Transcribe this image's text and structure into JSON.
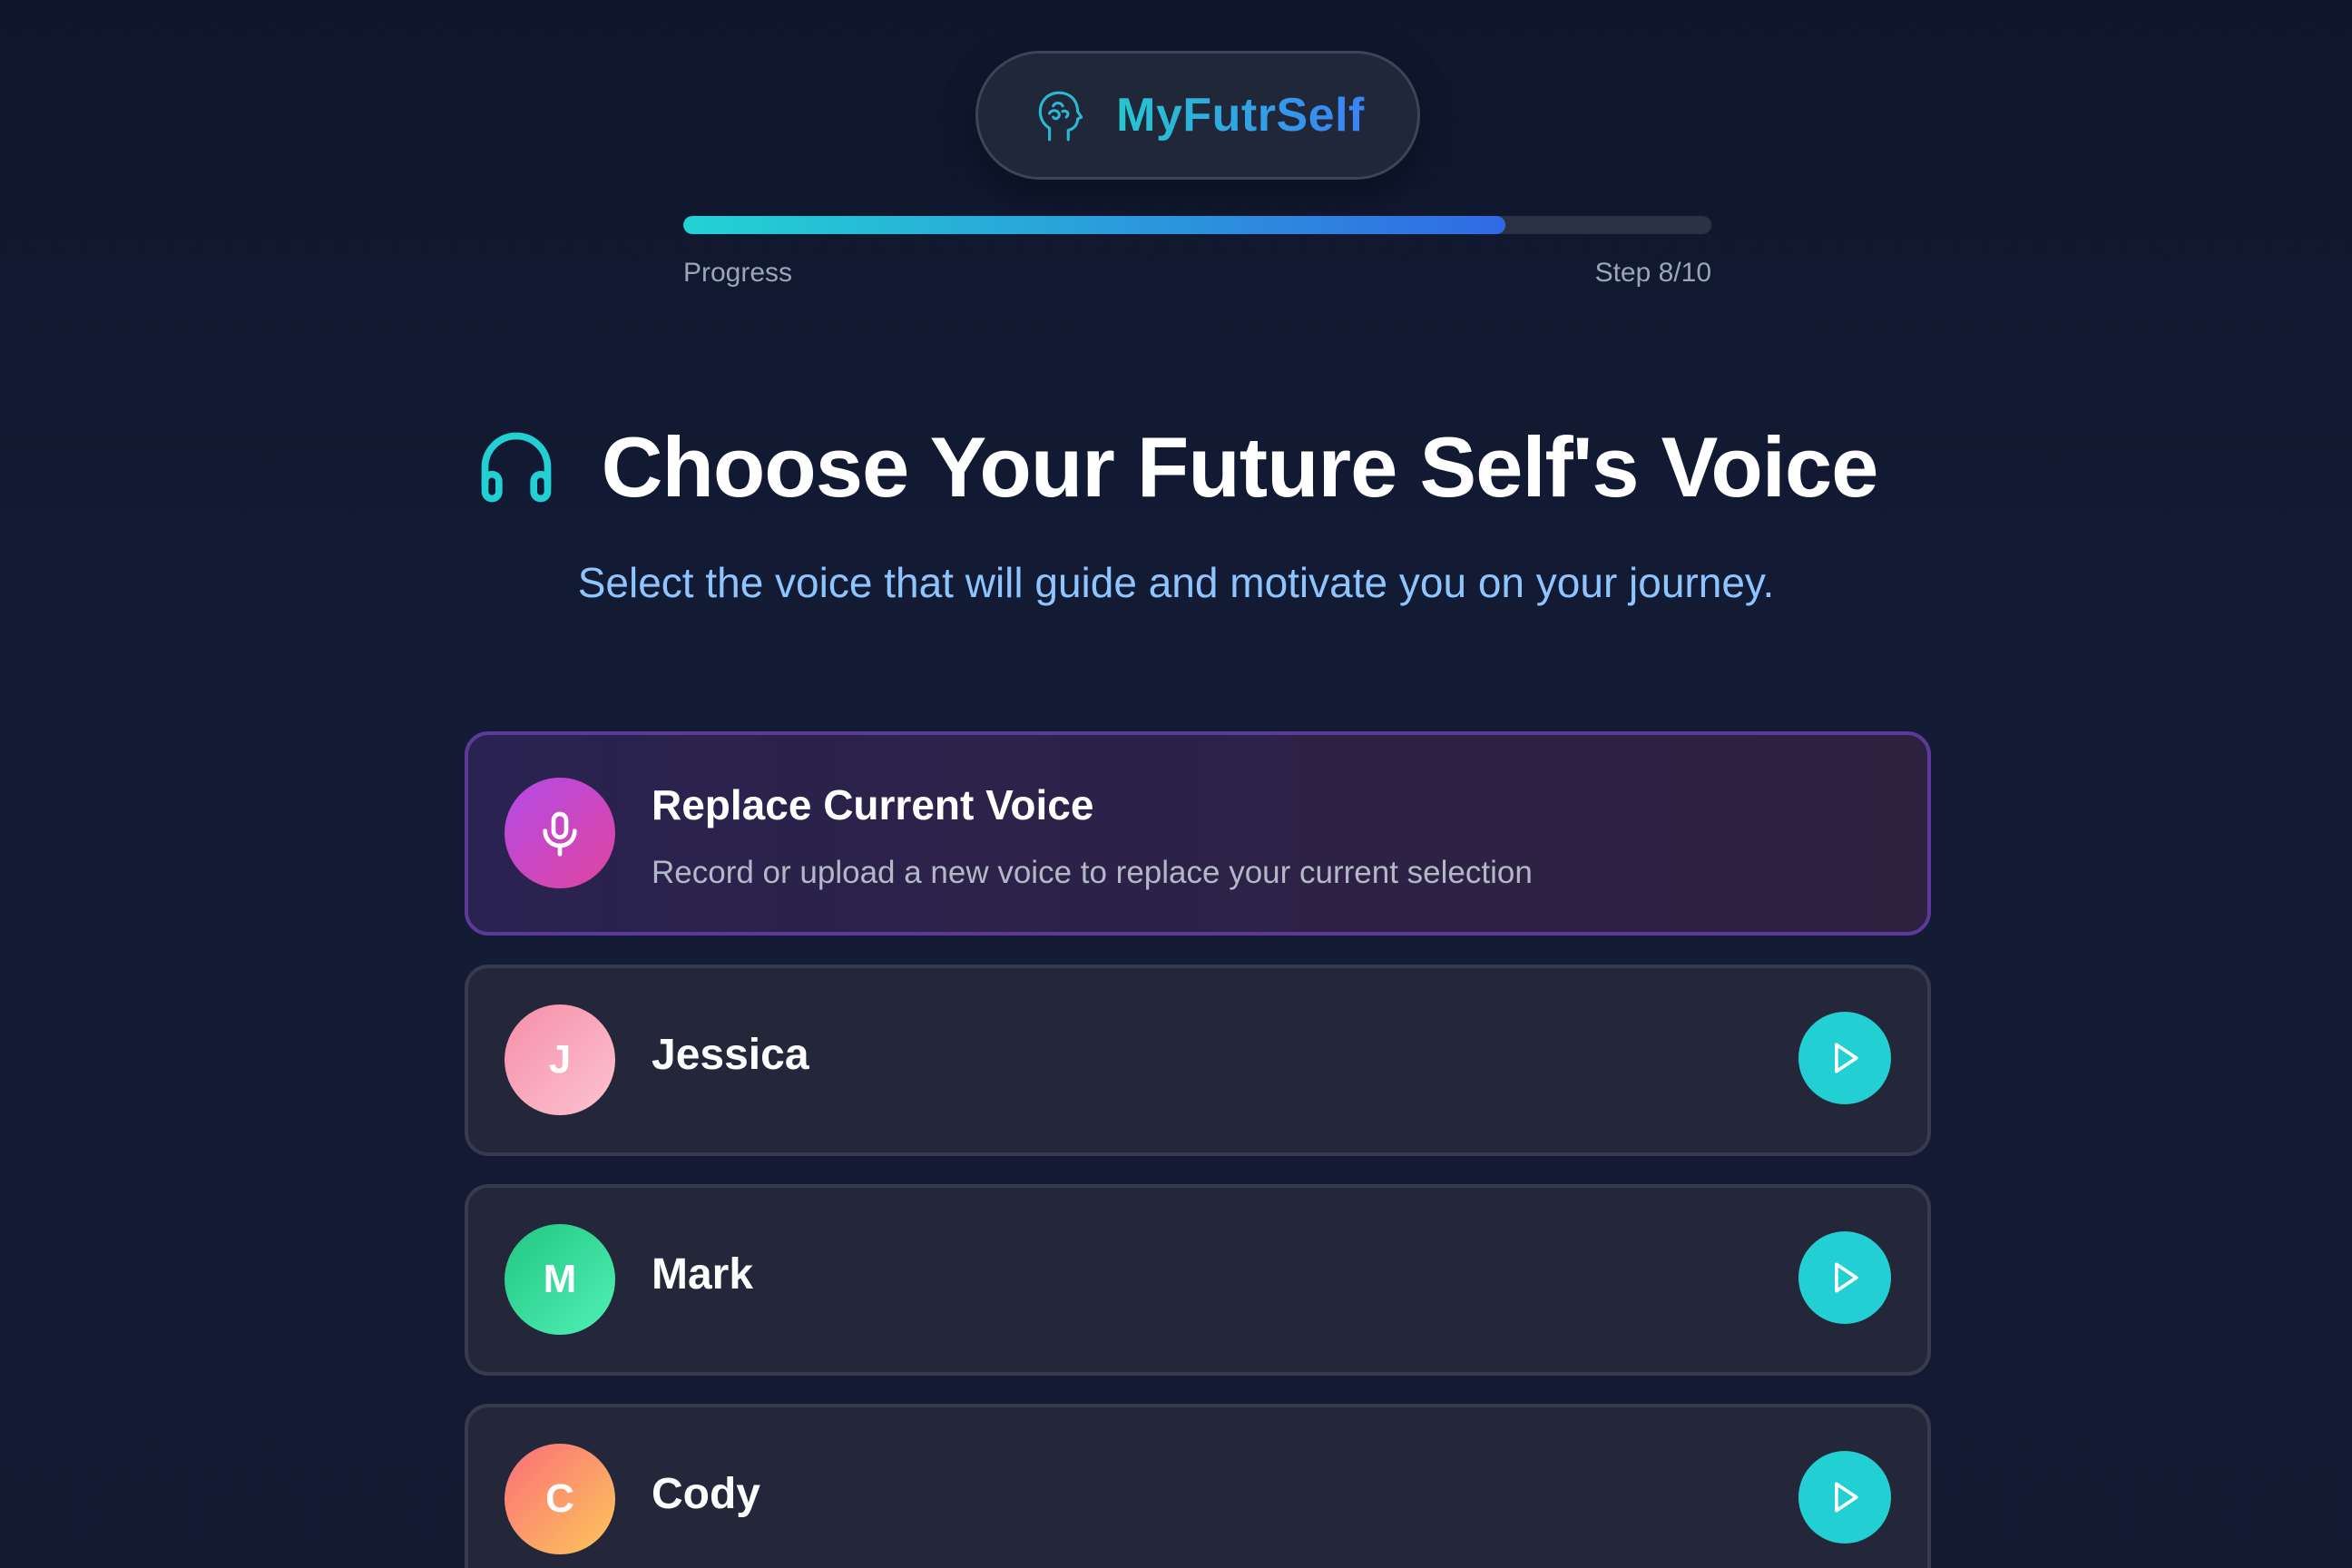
{
  "brand": {
    "name": "MyFutrSelf",
    "icon": "head-profile-icon"
  },
  "progress": {
    "label": "Progress",
    "step_text": "Step 8/10",
    "fraction": 0.8
  },
  "header": {
    "title": "Choose Your Future Self's Voice",
    "icon": "headphones-icon",
    "subtitle": "Select the voice that will guide and motivate you on your journey."
  },
  "replace_card": {
    "title": "Replace Current Voice",
    "description": "Record or upload a new voice to replace your current selection",
    "icon": "microphone-icon"
  },
  "voices": [
    {
      "name": "Jessica",
      "initial": "J"
    },
    {
      "name": "Mark",
      "initial": "M"
    },
    {
      "name": "Cody",
      "initial": "C"
    }
  ],
  "colors": {
    "accent": "#22cfd3",
    "brand_gradient_start": "#26c6cf",
    "brand_gradient_end": "#3b82f6",
    "replace_highlight": "#5b3a9a",
    "subtitle": "#8ec5ff"
  }
}
